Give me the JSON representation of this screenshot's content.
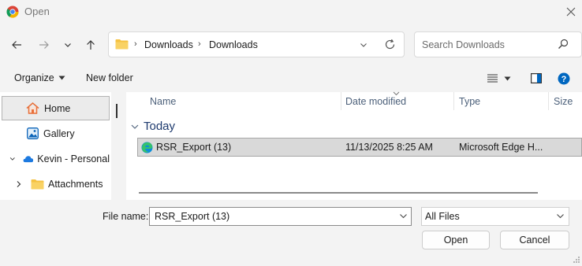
{
  "window": {
    "title": "Open",
    "icons": {
      "app": "chrome-icon",
      "close": "close-icon"
    }
  },
  "nav": {
    "breadcrumb": [
      "Downloads",
      "Downloads"
    ],
    "search_placeholder": "Search Downloads"
  },
  "commandbar": {
    "organize_label": "Organize",
    "new_folder_label": "New folder"
  },
  "sidebar": {
    "items": [
      {
        "label": "Home",
        "icon": "home-icon",
        "selected": true
      },
      {
        "label": "Gallery",
        "icon": "gallery-icon"
      },
      {
        "label": "Kevin - Personal",
        "icon": "onedrive-cloud-icon",
        "expanded": true
      },
      {
        "label": "Attachments",
        "icon": "folder-icon"
      }
    ]
  },
  "filelist": {
    "columns": [
      "Name",
      "Date modified",
      "Type",
      "Size"
    ],
    "group": "Today",
    "rows": [
      {
        "name": "RSR_Export (13)",
        "date": "11/13/2025 8:25 AM",
        "type": "Microsoft Edge H...",
        "icon": "edge-icon"
      }
    ]
  },
  "footer": {
    "filename_label": "File name:",
    "filename_value": "RSR_Export (13)",
    "filter_value": "All Files",
    "open_label": "Open",
    "cancel_label": "Cancel"
  },
  "colors": {
    "accent": "#0067c0",
    "folder": "#f5c242",
    "selection": "#d9d9d9",
    "header_text": "#4c607a",
    "group_text": "#1e3a6e"
  }
}
